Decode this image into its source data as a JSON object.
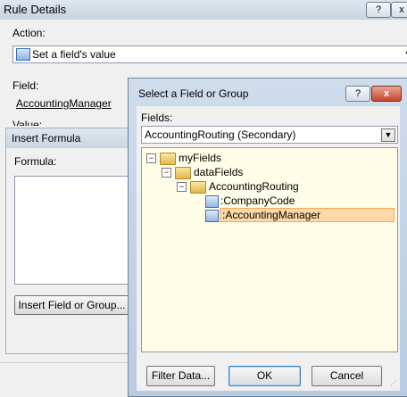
{
  "rule_details": {
    "title": "Rule Details",
    "help": "?",
    "close": "x",
    "action_label": "Action:",
    "action_value": "Set a field's value",
    "field_label": "Field:",
    "field_value": "AccountingManager",
    "value_label": "Value:"
  },
  "insert_formula": {
    "title": "Insert Formula",
    "formula_label": "Formula:",
    "formula_value": "",
    "insert_button": "Insert Field or Group..."
  },
  "select_dialog": {
    "title": "Select a Field or Group",
    "help": "?",
    "close": "x",
    "fields_label": "Fields:",
    "data_source": "AccountingRouting (Secondary)",
    "tree": {
      "root": "myFields",
      "child": "dataFields",
      "group": "AccountingRouting",
      "field1": ":CompanyCode",
      "field2": ":AccountingManager"
    },
    "filter_button": "Filter Data...",
    "ok_button": "OK",
    "cancel_button": "Cancel"
  }
}
